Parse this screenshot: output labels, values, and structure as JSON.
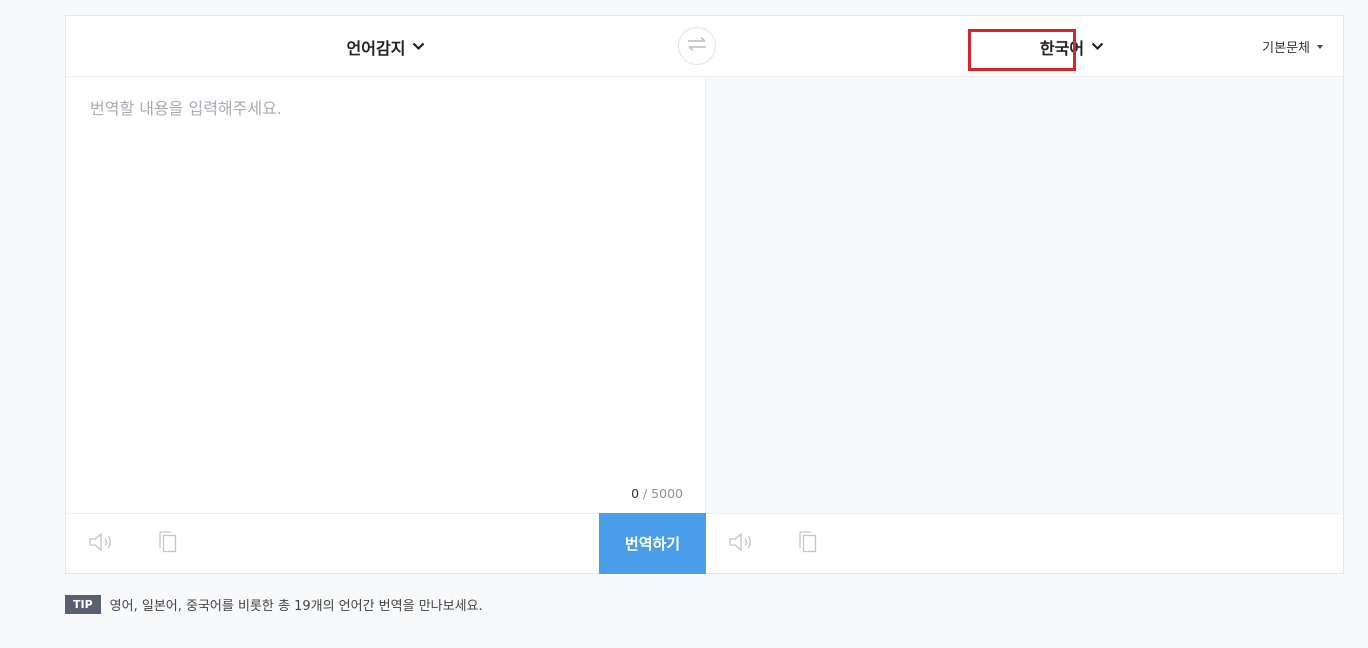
{
  "header": {
    "source_language": "언어감지",
    "target_language": "한국어",
    "font_style": "기본문체"
  },
  "source": {
    "placeholder": "번역할 내용을 입력해주세요.",
    "value": "",
    "char_count_current": "0",
    "char_count_max": "/ 5000"
  },
  "actions": {
    "translate_label": "번역하기"
  },
  "tip": {
    "badge": "TIP",
    "text": "영어, 일본어, 중국어를 비롯한 총 19개의 언어간 번역을 만나보세요."
  },
  "icons": {
    "swap": "swap-icon",
    "speaker": "speaker-icon",
    "copy": "copy-icon",
    "chevron": "chevron-down-icon"
  },
  "colors": {
    "accent": "#4a9de8",
    "highlight": "#d9232d",
    "tip_badge": "#5a6070"
  }
}
